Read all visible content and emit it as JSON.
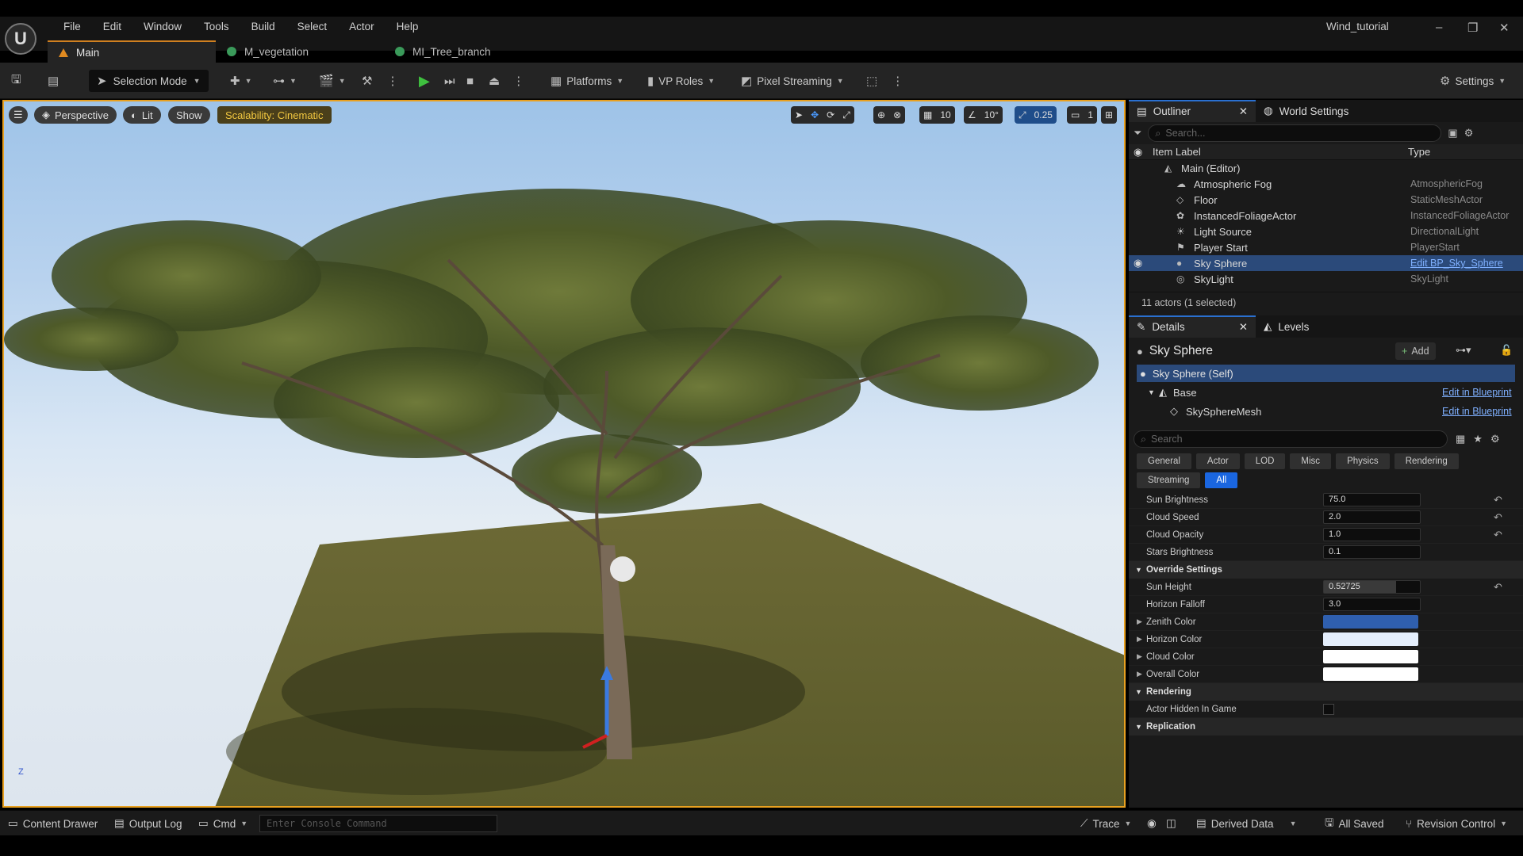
{
  "menu": [
    "File",
    "Edit",
    "Window",
    "Tools",
    "Build",
    "Select",
    "Actor",
    "Help"
  ],
  "project_name": "Wind_tutorial",
  "tabs": [
    {
      "label": "Main",
      "icon": "level-icon"
    },
    {
      "label": "M_vegetation",
      "icon": "material-icon"
    },
    {
      "label": "MI_Tree_branch",
      "icon": "material-instance-icon"
    }
  ],
  "toolbar": {
    "selection_mode": "Selection Mode",
    "platforms": "Platforms",
    "vp_roles": "VP Roles",
    "pixel_streaming": "Pixel Streaming",
    "settings": "Settings"
  },
  "viewport": {
    "perspective": "Perspective",
    "lit": "Lit",
    "show": "Show",
    "scalability": "Scalability: Cinematic",
    "grid_snap": "10",
    "rot_snap": "10°",
    "scale_snap": "0.25",
    "camera_speed": "1",
    "axis_z": "Z"
  },
  "outliner": {
    "tab": "Outliner",
    "world_settings": "World Settings",
    "search_placeholder": "Search...",
    "col_label": "Item Label",
    "col_type": "Type",
    "root": "Main (Editor)",
    "items": [
      {
        "label": "Atmospheric Fog",
        "type": "AtmosphericFog",
        "icon": "fog-icon"
      },
      {
        "label": "Floor",
        "type": "StaticMeshActor",
        "icon": "mesh-icon"
      },
      {
        "label": "InstancedFoliageActor",
        "type": "InstancedFoliageActor",
        "icon": "foliage-icon"
      },
      {
        "label": "Light Source",
        "type": "DirectionalLight",
        "icon": "sun-icon"
      },
      {
        "label": "Player Start",
        "type": "PlayerStart",
        "icon": "flag-icon"
      },
      {
        "label": "Sky Sphere",
        "type": "Edit BP_Sky_Sphere",
        "icon": "sphere-icon"
      },
      {
        "label": "SkyLight",
        "type": "SkyLight",
        "icon": "skylight-icon"
      }
    ],
    "footer": "11 actors (1 selected)"
  },
  "details": {
    "tab": "Details",
    "levels": "Levels",
    "actor_name": "Sky Sphere",
    "add": "Add",
    "self": "Sky Sphere (Self)",
    "base": "Base",
    "mesh": "SkySphereMesh",
    "edit_bp": "Edit in Blueprint",
    "search_placeholder": "Search",
    "filters": [
      "General",
      "Actor",
      "LOD",
      "Misc",
      "Physics",
      "Rendering",
      "Streaming",
      "All"
    ],
    "props_top": [
      {
        "label": "Sun Brightness",
        "value": "75.0"
      },
      {
        "label": "Cloud Speed",
        "value": "2.0"
      },
      {
        "label": "Cloud Opacity",
        "value": "1.0"
      },
      {
        "label": "Stars Brightness",
        "value": "0.1"
      }
    ],
    "override_section": "Override Settings",
    "sun_height_label": "Sun Height",
    "sun_height": "0.52725",
    "horizon_falloff_label": "Horizon Falloff",
    "horizon_falloff": "3.0",
    "colors": [
      {
        "label": "Zenith Color",
        "color": "#2f5fae"
      },
      {
        "label": "Horizon Color",
        "color": "#e4eefc"
      },
      {
        "label": "Cloud Color",
        "color": "#ffffff"
      },
      {
        "label": "Overall Color",
        "color": "#ffffff"
      }
    ],
    "rendering_section": "Rendering",
    "hidden_label": "Actor Hidden In Game",
    "replication_section": "Replication"
  },
  "status": {
    "content_drawer": "Content Drawer",
    "output_log": "Output Log",
    "cmd": "Cmd",
    "console_placeholder": "Enter Console Command",
    "trace": "Trace",
    "derived_data": "Derived Data",
    "all_saved": "All Saved",
    "revision_control": "Revision Control"
  },
  "accent": "#e8a020"
}
